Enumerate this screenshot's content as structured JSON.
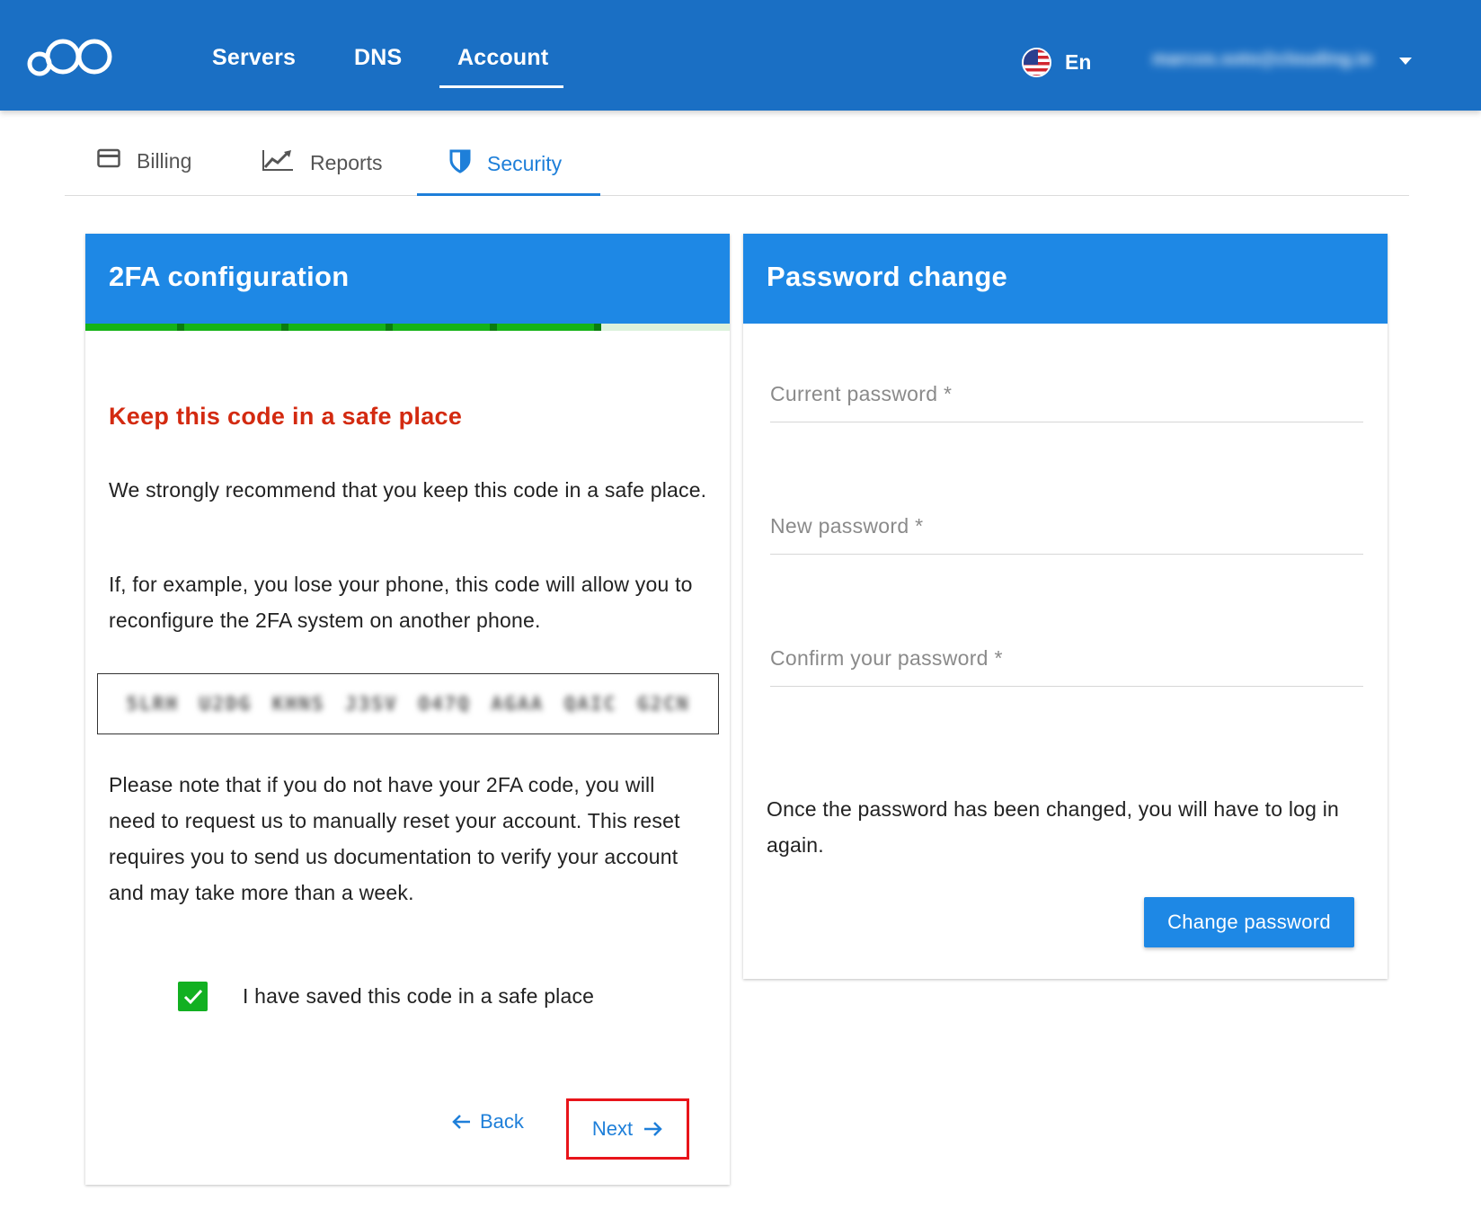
{
  "topbar": {
    "nav": [
      {
        "label": "Servers"
      },
      {
        "label": "DNS"
      },
      {
        "label": "Account"
      }
    ],
    "language": "En",
    "user_email": "marcos.soto@clouding.io",
    "icons": {
      "logo": "cloud-logo-icon",
      "flag": "us-flag-icon",
      "caret": "caret-down-icon"
    }
  },
  "subtabs": [
    {
      "label": "Billing",
      "icon": "credit-card-icon"
    },
    {
      "label": "Reports",
      "icon": "line-chart-icon"
    },
    {
      "label": "Security",
      "icon": "shield-icon",
      "active": true
    }
  ],
  "twofa": {
    "title": "2FA configuration",
    "progress": {
      "steps_done": 5,
      "steps_total": 6
    },
    "warning_title": "Keep this code in a safe place",
    "para1": "We strongly recommend that you keep this code in a safe place.",
    "para2": "If, for example, you lose your phone, this code will allow you to reconfigure the 2FA system on another phone.",
    "code": "5LRH U2DG KHNS J3SV O47Q AGAA QAIC G2CN",
    "para3": "Please note that if you do not have your 2FA code, you will need to request us to manually reset your account. This reset requires you to send us documentation to verify your account and may take more than a week.",
    "checkbox_label": "I have saved this code in a safe place",
    "checkbox_checked": true,
    "back_label": "Back",
    "next_label": "Next"
  },
  "password": {
    "title": "Password change",
    "current_placeholder": "Current password *",
    "new_placeholder": "New password *",
    "confirm_placeholder": "Confirm your password *",
    "note": "Once the password has been changed, you will have to log in again.",
    "button_label": "Change password"
  },
  "colors": {
    "topbar": "#1a6fc4",
    "card_header": "#1e88e5",
    "accent": "#1e7fd9",
    "warning": "#d32a10",
    "progress_done": "#15b318",
    "highlight_border": "#e8141a"
  }
}
